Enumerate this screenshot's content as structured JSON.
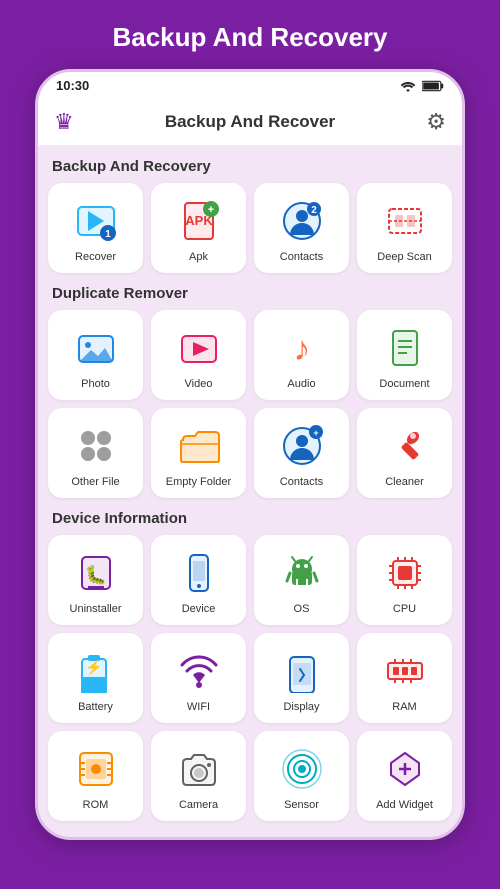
{
  "pageTitle": "Backup And Recovery",
  "statusBar": {
    "time": "10:30"
  },
  "topBar": {
    "title": "Backup And Recover"
  },
  "sections": [
    {
      "id": "backup",
      "label": "Backup And Recovery",
      "items": [
        {
          "id": "recover",
          "label": "Recover",
          "icon": "recover"
        },
        {
          "id": "apk",
          "label": "Apk",
          "icon": "apk"
        },
        {
          "id": "contacts",
          "label": "Contacts",
          "icon": "contacts"
        },
        {
          "id": "deepscan",
          "label": "Deep Scan",
          "icon": "deepscan"
        }
      ]
    },
    {
      "id": "duplicate",
      "label": "Duplicate Remover",
      "items": [
        {
          "id": "photo",
          "label": "Photo",
          "icon": "photo"
        },
        {
          "id": "video",
          "label": "Video",
          "icon": "video"
        },
        {
          "id": "audio",
          "label": "Audio",
          "icon": "audio"
        },
        {
          "id": "document",
          "label": "Document",
          "icon": "document"
        },
        {
          "id": "otherfile",
          "label": "Other File",
          "icon": "otherfile"
        },
        {
          "id": "emptyfolder",
          "label": "Empty Folder",
          "icon": "emptyfolder"
        },
        {
          "id": "contactsdup",
          "label": "Contacts",
          "icon": "contactsdup"
        },
        {
          "id": "cleaner",
          "label": "Cleaner",
          "icon": "cleaner"
        }
      ]
    },
    {
      "id": "device",
      "label": "Device Information",
      "items": [
        {
          "id": "uninstaller",
          "label": "Uninstaller",
          "icon": "uninstaller"
        },
        {
          "id": "device",
          "label": "Device",
          "icon": "device"
        },
        {
          "id": "os",
          "label": "OS",
          "icon": "os"
        },
        {
          "id": "cpu",
          "label": "CPU",
          "icon": "cpu"
        },
        {
          "id": "battery",
          "label": "Battery",
          "icon": "battery"
        },
        {
          "id": "wifi",
          "label": "WIFI",
          "icon": "wifi"
        },
        {
          "id": "display",
          "label": "Display",
          "icon": "display"
        },
        {
          "id": "ram",
          "label": "RAM",
          "icon": "ram"
        },
        {
          "id": "rom",
          "label": "ROM",
          "icon": "rom"
        },
        {
          "id": "camera",
          "label": "Camera",
          "icon": "camera"
        },
        {
          "id": "sensor",
          "label": "Sensor",
          "icon": "sensor"
        },
        {
          "id": "addwidget",
          "label": "Add Widget",
          "icon": "addwidget"
        }
      ]
    }
  ]
}
